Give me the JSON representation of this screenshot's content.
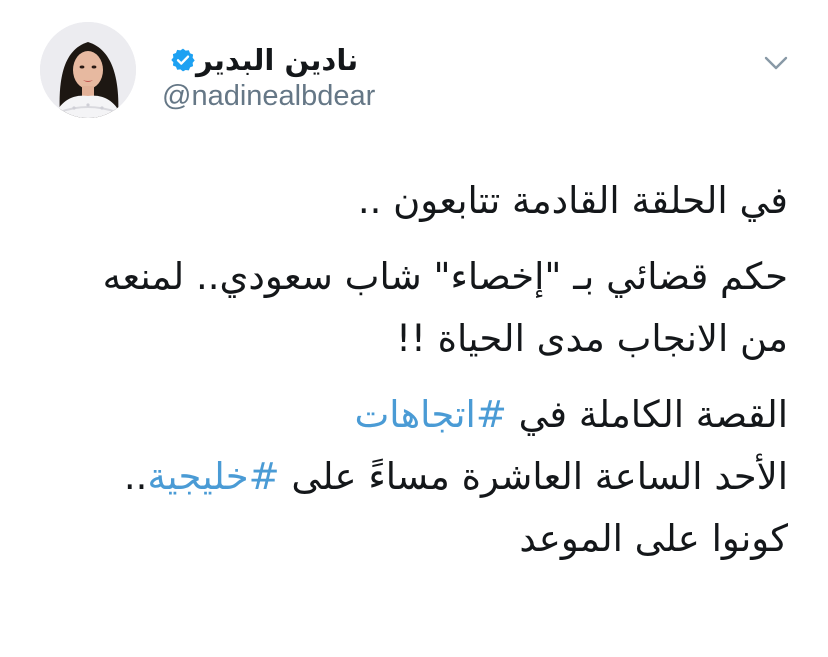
{
  "user": {
    "display_name": "نادين البدير",
    "handle": "@nadinealbdear",
    "verified": true,
    "avatar_icon": "profile-photo"
  },
  "menu": {
    "icon": "chevron-down-icon"
  },
  "tweet": {
    "line1": "في الحلقة القادمة تتابعون ..",
    "line2": "حكم قضائي بـ \"إخصاء\" شاب سعودي.. لمنعه",
    "line3": "من الانجاب مدى الحياة !!",
    "line4_text": "القصة الكاملة في ",
    "line4_hashtag": "#اتجاهات",
    "line5_text": "الأحد الساعة العاشرة مساءً على ",
    "line5_hashtag": "#خليجية",
    "line5_suffix": "..",
    "line6": "كونوا على الموعد"
  },
  "colors": {
    "hashtag": "#4a9bd5",
    "verified_badge": "#1da1f2",
    "handle": "#657786",
    "text": "#14171a"
  }
}
